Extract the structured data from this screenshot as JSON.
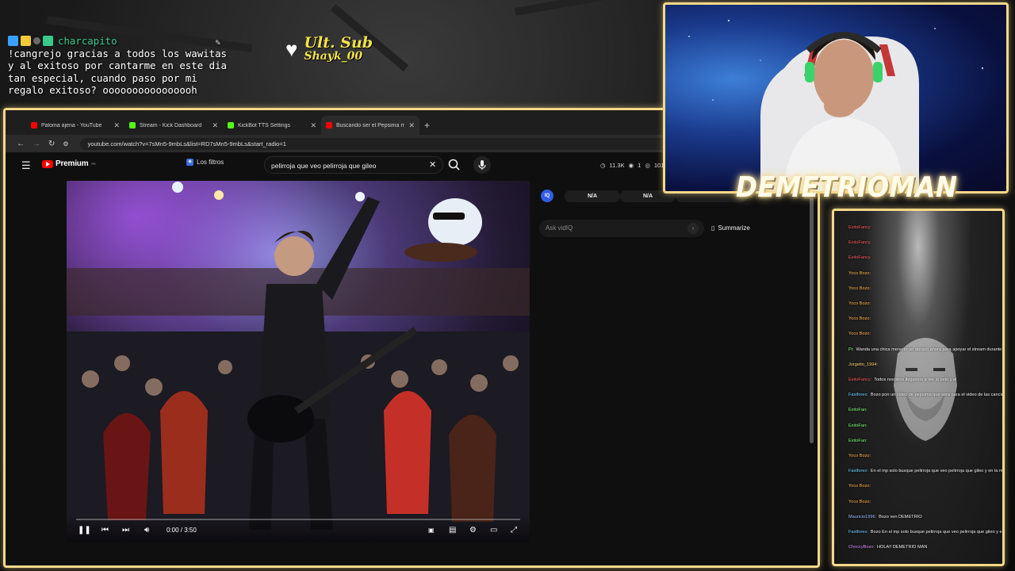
{
  "overlay_chat": {
    "username": "charcapito",
    "message": "!cangrejo gracias a todos los wawitas\ny al exitoso por cantarme en este dia\ntan especial, cuando paso por mi\nregalo exitoso? oooooooooooooooh"
  },
  "last_sub": {
    "label": "Ult. Sub",
    "name": "Shayk_00"
  },
  "browser": {
    "tabs": [
      {
        "label": "Paloma ajena - YouTube",
        "favicon_color": "#ff0000"
      },
      {
        "label": "Stream - Kick Dashboard",
        "favicon_color": "#53fc18"
      },
      {
        "label": "KickBot TTS Settings",
        "favicon_color": "#53fc18"
      },
      {
        "label": "Buscando ser el Pepsima más Pelirroja",
        "favicon_color": "#ff0000"
      }
    ],
    "new_tab": "+",
    "url": "youtube.com/watch?v=7sMn5-9mbLs&list=RD7sMn5-9mbLs&start_radio=1"
  },
  "youtube": {
    "brand": "Premium",
    "brand_sup": "PE",
    "filters_label": "Los filtros",
    "search_value": "pelirroja que veo pelirroja que gileo",
    "stats": {
      "count": "11.3K",
      "viewers": "1",
      "other": "101"
    },
    "player": {
      "time": "0:00 / 3:50",
      "progress": 0
    }
  },
  "side_panel": {
    "badge": "IQ",
    "pill_1": "N/A",
    "pill_2": "N/A",
    "ask_placeholder": "Ask vidIQ",
    "summarize": "Summarize"
  },
  "streamer_name": "DEMETRIOMAN",
  "kick_chat": [
    {
      "user": "ExitoFancy",
      "text": "",
      "color": "#ff5a5a"
    },
    {
      "user": "ExitoFancy",
      "text": "",
      "color": "#ff5a5a"
    },
    {
      "user": "ExitoFancy",
      "text": "",
      "color": "#ff5a5a"
    },
    {
      "user": "Yoco Bozo:",
      "text": "",
      "color": "#ffb347"
    },
    {
      "user": "Yoco Bozo:",
      "text": "",
      "color": "#ffb347"
    },
    {
      "user": "Yoco Bozo:",
      "text": "",
      "color": "#ffb347"
    },
    {
      "user": "Yoco Bozo:",
      "text": "",
      "color": "#ffb347"
    },
    {
      "user": "Yoco Bozo:",
      "text": "",
      "color": "#ffb347"
    },
    {
      "user": "Pi:",
      "text": "Wanda una chica merecer un abrazo ahora para apoyar el stream durante este mensaje",
      "color": "#7cff7c"
    },
    {
      "user": "Jorgeito_1994:",
      "text": "",
      "color": "#ffd36b"
    },
    {
      "user": "ExitoFancy:",
      "text": "Todos nosotros llegamos a ver la pelo y el",
      "color": "#ff5a5a"
    },
    {
      "user": "Fastforex:",
      "text": "Bozo pon un video de pepsima que sera para el video de las canciones",
      "color": "#6bd1ff"
    },
    {
      "user": "ExitoFan:",
      "text": "",
      "color": "#7cff7c"
    },
    {
      "user": "ExitoFan:",
      "text": "",
      "color": "#7cff7c"
    },
    {
      "user": "ExitoFan:",
      "text": "",
      "color": "#7cff7c"
    },
    {
      "user": "Yoco Bozo:",
      "text": "",
      "color": "#ffb347"
    },
    {
      "user": "Fastforex:",
      "text": "En el mp solo busque pelirroja que veo pelirroja que gileo y en la misma cuenta estan las otras ?",
      "color": "#6bd1ff"
    },
    {
      "user": "Yoco Bozo:",
      "text": "",
      "color": "#ffb347"
    },
    {
      "user": "Yoco Bozo:",
      "text": "",
      "color": "#ffb347"
    },
    {
      "user": "Mauricio1996:",
      "text": "Bozo ven DEMETRIO",
      "color": "#9bbcff"
    },
    {
      "user": "Fastforex:",
      "text": "Bozo En el mp solo busque pelirroja que veo pelirroja que gileo y en la misma cuenta estan las otras ?",
      "color": "#6bd1ff"
    },
    {
      "user": "ChoccyBozo:",
      "text": "HOLA!! DEMETRIO MAN",
      "color": "#d98cff"
    }
  ]
}
